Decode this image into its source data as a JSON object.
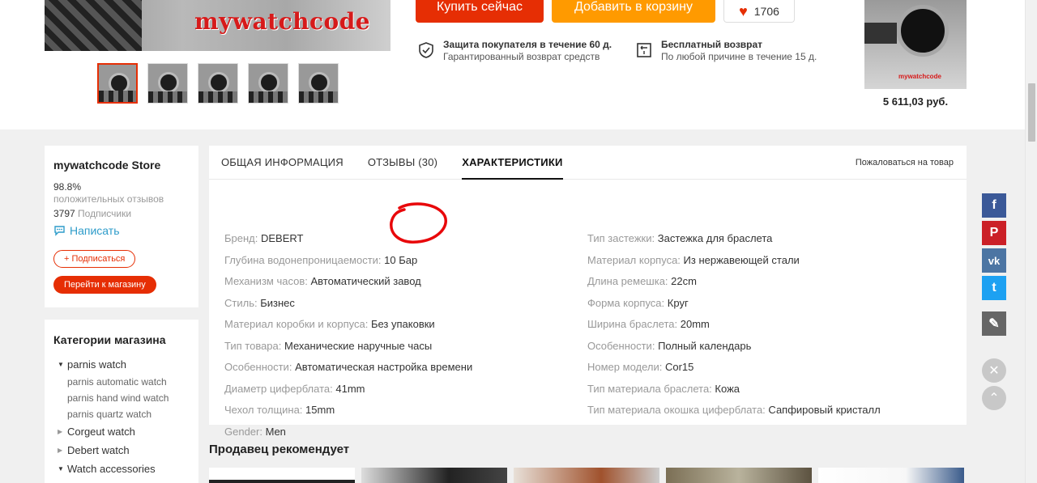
{
  "product": {
    "watermark": "mywatchcode",
    "thumbnails": [
      "thumb-1",
      "thumb-2",
      "thumb-3",
      "thumb-4",
      "thumb-5"
    ]
  },
  "actions": {
    "buy_now": "Купить сейчас",
    "add_to_cart": "Добавить в корзину",
    "wishlist_count": "1706"
  },
  "guarantees": [
    {
      "title": "Защита покупателя в течение 60 д.",
      "subtitle": "Гарантированный возврат средств",
      "icon": "shield-check-icon"
    },
    {
      "title": "Бесплатный возврат",
      "subtitle": "По любой причине в течение 15 д.",
      "icon": "return-box-icon"
    }
  ],
  "side_product": {
    "watermark": "mywatchcode",
    "price": "5 611,03 руб."
  },
  "store": {
    "name": "mywatchcode Store",
    "rating": "98.8%",
    "rating_label": "положительных отзывов",
    "subscribers_count": "3797",
    "subscribers_label": "Подписчики",
    "write_label": "Написать",
    "subscribe_label": "+ Подписаться",
    "go_to_store_label": "Перейти к магазину"
  },
  "categories": {
    "title": "Категории магазина",
    "items": [
      {
        "label": "parnis watch",
        "expanded": true
      },
      {
        "label": "parnis automatic watch",
        "sub": true
      },
      {
        "label": "parnis hand wind watch",
        "sub": true
      },
      {
        "label": "parnis quartz watch",
        "sub": true
      },
      {
        "label": "Corgeut watch",
        "expanded": false
      },
      {
        "label": "Debert watch",
        "expanded": false
      },
      {
        "label": "Watch accessories",
        "expanded": true
      }
    ]
  },
  "tabs": {
    "general": "ОБЩАЯ ИНФОРМАЦИЯ",
    "reviews": "ОТЗЫВЫ (30)",
    "specs": "ХАРАКТЕРИСТИКИ",
    "report": "Пожаловаться на товар"
  },
  "specs": {
    "left": [
      {
        "key": "Бренд:",
        "value": "DEBERT"
      },
      {
        "key": "Глубина водонепроницаемости:",
        "value": "10 Бар"
      },
      {
        "key": "Механизм часов:",
        "value": "Автоматический завод"
      },
      {
        "key": "Стиль:",
        "value": "Бизнес"
      },
      {
        "key": "Материал коробки и корпуса:",
        "value": "Без упаковки"
      },
      {
        "key": "Тип товара:",
        "value": "Механические наручные часы"
      },
      {
        "key": "Особенности:",
        "value": "Автоматическая настройка времени"
      },
      {
        "key": "Диаметр циферблата:",
        "value": "41mm"
      },
      {
        "key": "Чехол толщина:",
        "value": "15mm"
      },
      {
        "key": "Gender:",
        "value": "Men"
      }
    ],
    "right": [
      {
        "key": "Тип застежки:",
        "value": "Застежка для браслета"
      },
      {
        "key": "Материал корпуса:",
        "value": "Из нержавеющей стали"
      },
      {
        "key": "Длина ремешка:",
        "value": "22cm"
      },
      {
        "key": "Форма корпуса:",
        "value": "Круг"
      },
      {
        "key": "Ширина браслета:",
        "value": "20mm"
      },
      {
        "key": "Особенности:",
        "value": "Полный календарь"
      },
      {
        "key": "Номер модели:",
        "value": "Cor15"
      },
      {
        "key": "Тип материала браслета:",
        "value": "Кожа"
      },
      {
        "key": "Тип материала окошка циферблата:",
        "value": "Сапфировый кристалл"
      }
    ]
  },
  "recommend": {
    "title": "Продавец рекомендует"
  },
  "social": {
    "facebook": "f",
    "pinterest": "P",
    "vk": "vk",
    "twitter": "t",
    "edit": "✎",
    "close": "✕",
    "up": "⌃"
  },
  "colors": {
    "accent": "#e62e04",
    "cart": "#ff9a00",
    "link": "#2e9cca"
  }
}
